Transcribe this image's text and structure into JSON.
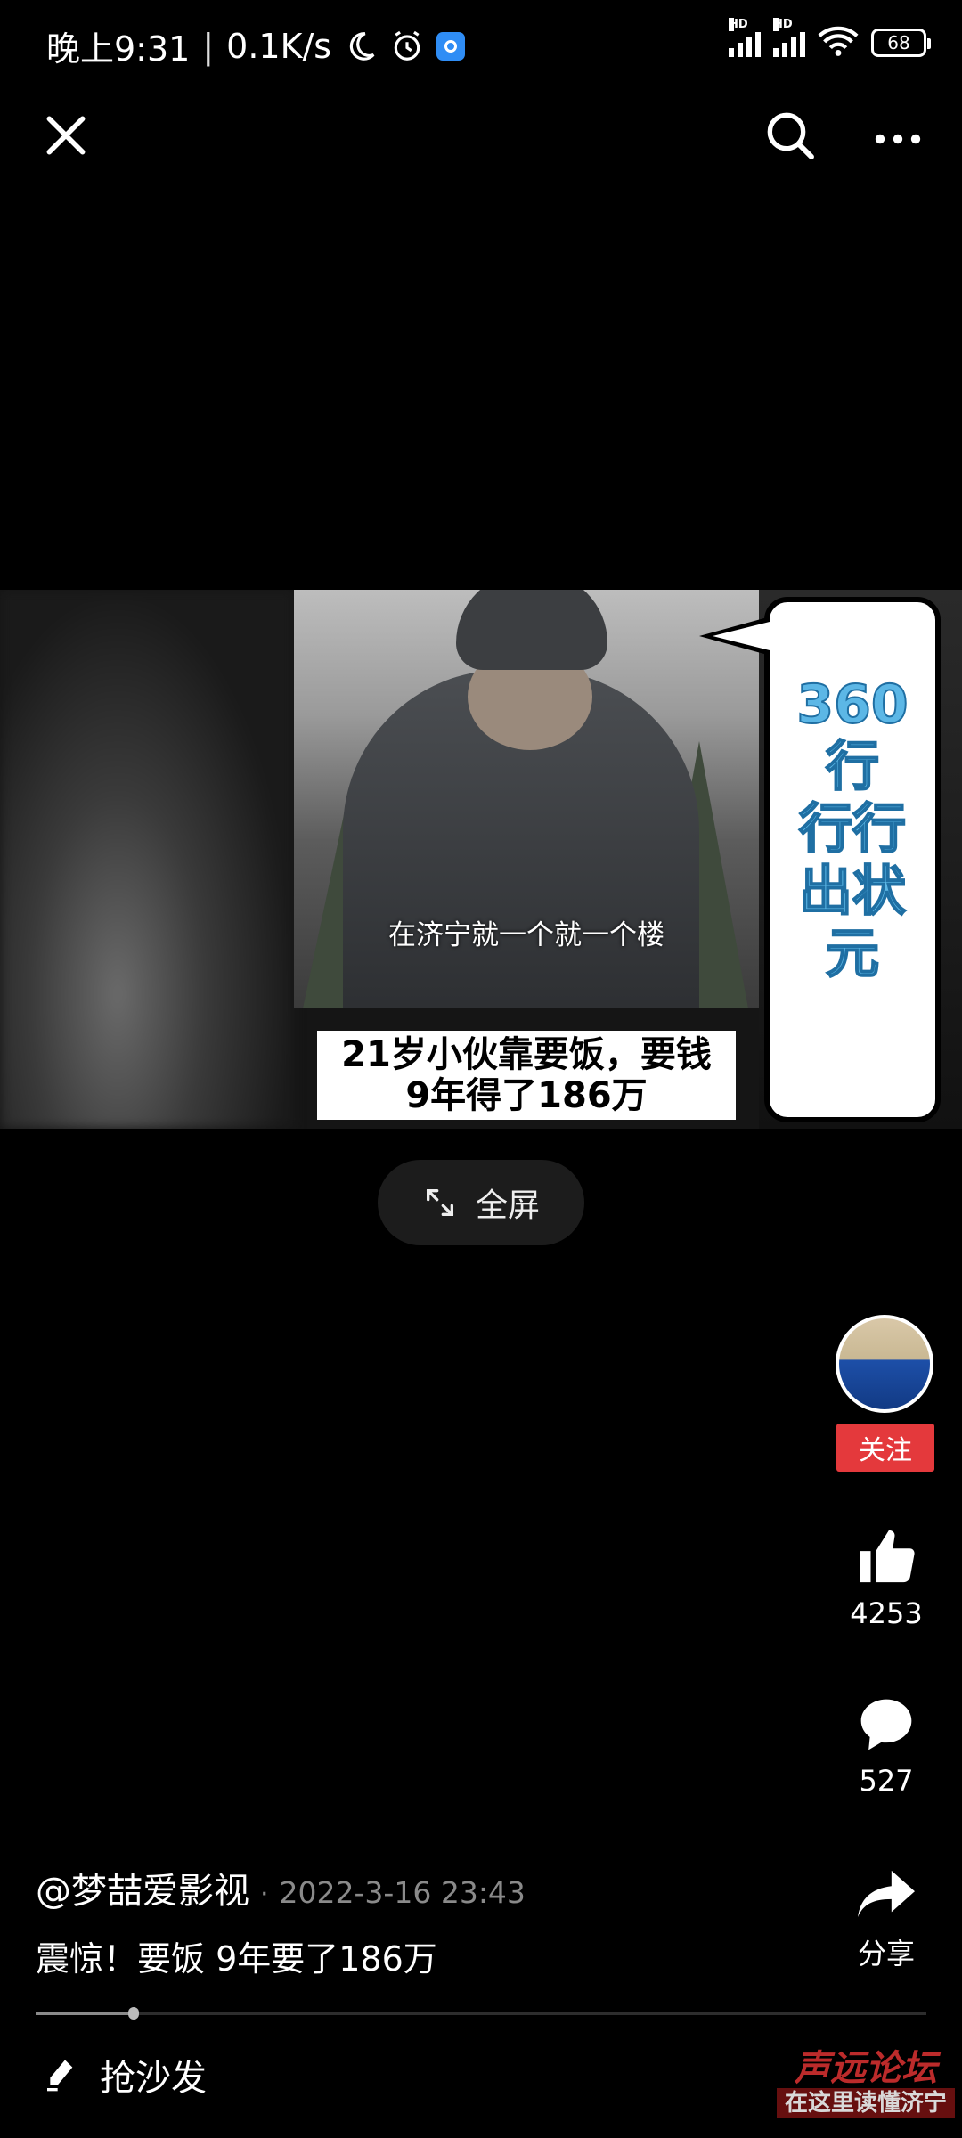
{
  "status_bar": {
    "time": "晚上9:31",
    "speed": "0.1K/s",
    "battery": "68",
    "hd1": "HD",
    "hd2": "HD"
  },
  "video": {
    "subtitle": "在济宁就一个就一个楼",
    "caption_line1": "21岁小伙靠要饭，要钱",
    "caption_line2": "9年得了186万",
    "bubble_text": "360行行行出状元"
  },
  "fullscreen_label": "全屏",
  "author": {
    "follow_label": "关注",
    "handle": "@梦喆爱影视",
    "separator": "·",
    "timestamp": "2022-3-16 23:43"
  },
  "rail": {
    "likes": "4253",
    "comments": "527",
    "share_label": "分享"
  },
  "description": "震惊！要饭 9年要了186万",
  "comment_placeholder": "抢沙发",
  "progress": 0.11,
  "watermark": {
    "title": "声远论坛",
    "subtitle": "在这里读懂济宁"
  }
}
